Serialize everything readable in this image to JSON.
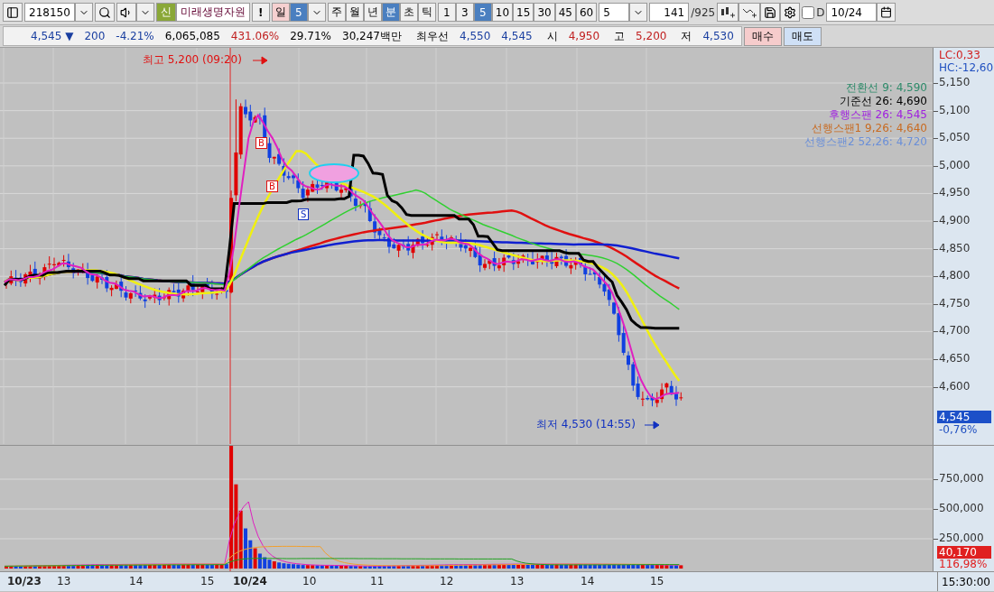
{
  "toolbar": {
    "code": "218150",
    "badge": "신",
    "name": "미래생명자원",
    "alert": "!",
    "period": {
      "label": "일",
      "value": "5"
    },
    "units": [
      {
        "label": "주",
        "selected": false
      },
      {
        "label": "월",
        "selected": false
      },
      {
        "label": "년",
        "selected": false
      },
      {
        "label": "분",
        "selected": true
      },
      {
        "label": "초",
        "selected": false
      },
      {
        "label": "틱",
        "selected": false
      }
    ],
    "minutes": [
      {
        "label": "1",
        "selected": false
      },
      {
        "label": "3",
        "selected": false
      },
      {
        "label": "5",
        "selected": true
      },
      {
        "label": "10",
        "selected": false
      },
      {
        "label": "15",
        "selected": false
      },
      {
        "label": "30",
        "selected": false
      },
      {
        "label": "45",
        "selected": false
      },
      {
        "label": "60",
        "selected": false
      }
    ],
    "interval": "5",
    "count": "141",
    "total": "/925",
    "d_option": {
      "label": "D",
      "checked": false
    },
    "date": "10/24"
  },
  "quote": [
    {
      "text": "4,545",
      "arrow": "▼",
      "color": "#1a3fa0"
    },
    {
      "text": "200",
      "color": "#1a3fa0"
    },
    {
      "text": "-4.21%",
      "color": "#1a3fa0"
    },
    {
      "text": "6,065,085",
      "color": "#000000"
    },
    {
      "text": "431.06%",
      "color": "#c02020"
    },
    {
      "text": "29.71%",
      "color": "#000000"
    },
    {
      "text": "30,247백만",
      "color": "#000000"
    },
    {
      "text": "최우선",
      "kind": "label"
    },
    {
      "text": "4,550",
      "color": "#1a3fa0"
    },
    {
      "text": "4,545",
      "color": "#1a3fa0"
    },
    {
      "text": "시",
      "kind": "label"
    },
    {
      "text": "4,950",
      "color": "#c02020"
    },
    {
      "text": "고",
      "kind": "label"
    },
    {
      "text": "5,200",
      "color": "#c02020"
    },
    {
      "text": "저",
      "kind": "label"
    },
    {
      "text": "4,530",
      "color": "#1a3fa0"
    }
  ],
  "order_buttons": [
    {
      "label": "매수",
      "kind": "buy"
    },
    {
      "label": "매도",
      "kind": "sell"
    }
  ],
  "chart": {
    "lc": "LC:0,33",
    "hc": "HC:-12,60",
    "legend": [
      {
        "text": "전환선 9: 4,590",
        "color": "#2e8b6a"
      },
      {
        "text": "기준선 26: 4,690",
        "color": "#000000"
      },
      {
        "text": "후행스팬 26: 4,545",
        "color": "#a020e0"
      },
      {
        "text": "선행스팬1 9,26: 4,640",
        "color": "#c86a20"
      },
      {
        "text": "선행스팬2 52,26: 4,720",
        "color": "#6a8fd8"
      }
    ],
    "high_note": "최고 5,200 (09:20)",
    "low_note": "최저 4,530 (14:55)",
    "signals": [
      {
        "label": "B",
        "kind": "buy"
      },
      {
        "label": "B",
        "kind": "buy"
      },
      {
        "label": "S",
        "kind": "sell"
      }
    ],
    "price_ticks": [
      "5,150",
      "5,100",
      "5,050",
      "5,000",
      "4,950",
      "4,900",
      "4,850",
      "4,800",
      "4,750",
      "4,700",
      "4,650",
      "4,600"
    ],
    "price_tag": "4,545",
    "price_change": "-0,76%",
    "volume_ticks": [
      "750,000",
      "500,000",
      "250,000"
    ],
    "volume_tag": "40,170",
    "volume_ratio": "116,98%",
    "x_labels": [
      {
        "text": "10/23",
        "day": true
      },
      {
        "text": "13",
        "day": false
      },
      {
        "text": "14",
        "day": false
      },
      {
        "text": "15",
        "day": false
      },
      {
        "text": "10/24",
        "day": true
      },
      {
        "text": "10",
        "day": false
      },
      {
        "text": "11",
        "day": false
      },
      {
        "text": "12",
        "day": false
      },
      {
        "text": "13",
        "day": false
      },
      {
        "text": "14",
        "day": false
      },
      {
        "text": "15",
        "day": false
      }
    ],
    "time": "15:30:00"
  }
}
